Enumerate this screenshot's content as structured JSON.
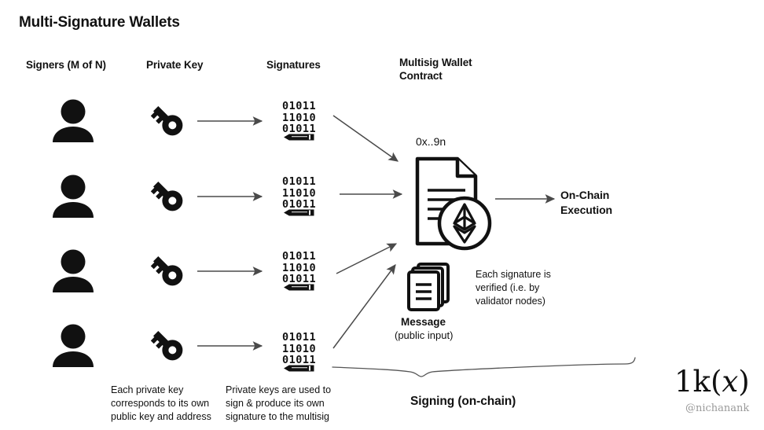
{
  "title": "Multi-Signature Wallets",
  "columns": {
    "signers": "Signers (M of N)",
    "private_key": "Private Key",
    "signatures": "Signatures",
    "wallet_line1": "Multisig Wallet",
    "wallet_line2": "Contract"
  },
  "signature_value": "01011\n11010\n01011",
  "signers": [
    {
      "icon": "person-icon",
      "key_icon": "key-icon",
      "signature": "01011\n11010\n01011"
    },
    {
      "icon": "person-icon",
      "key_icon": "key-icon",
      "signature": "01011\n11010\n01011"
    },
    {
      "icon": "person-icon",
      "key_icon": "key-icon",
      "signature": "01011\n11010\n01011"
    },
    {
      "icon": "person-icon",
      "key_icon": "key-icon",
      "signature": "01011\n11010\n01011"
    }
  ],
  "wallet": {
    "address": "0x..9n",
    "doc_icon": "document-icon",
    "chain_badge_icon": "ethereum-icon"
  },
  "execution": {
    "line1": "On-Chain",
    "line2": "Execution"
  },
  "message": {
    "icon": "message-stack-icon",
    "title": "Message",
    "subtitle": "(public input)"
  },
  "notes": {
    "verification": "Each signature is verified (i.e. by validator nodes)",
    "private_key_note": "Each private key corresponds to its own public key and address",
    "signing_note": "Private keys are used to sign & produce its own signature to the multisig",
    "brace_label": "Signing (on-chain)"
  },
  "watermark": {
    "logo_prefix": "1k(",
    "logo_italic": "x",
    "logo_suffix": ")",
    "handle": "@nichanank"
  },
  "colors": {
    "background": "#ffffff",
    "ink": "#111111",
    "arrow": "#555555",
    "muted": "#9a9a9a"
  }
}
